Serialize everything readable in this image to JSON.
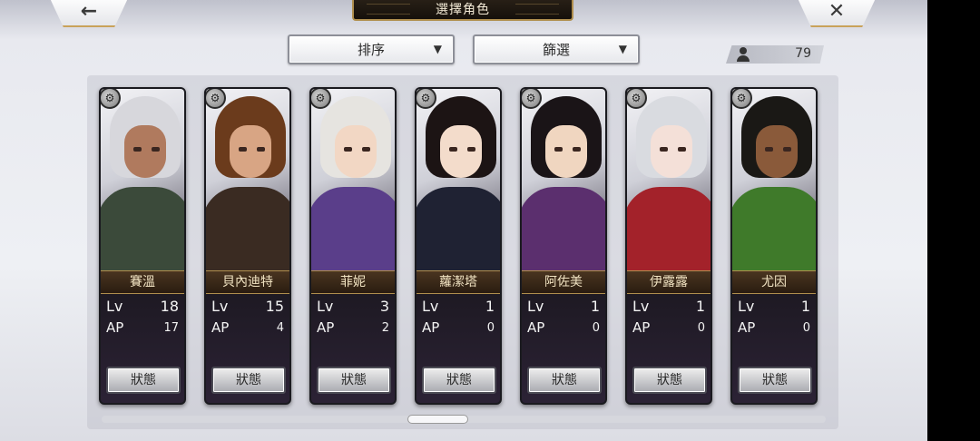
{
  "header": {
    "title": "選擇角色"
  },
  "nav": {
    "back_icon": "←",
    "close_icon": "✕"
  },
  "toolbar": {
    "sort_label": "排序",
    "filter_label": "篩選",
    "dropdown_arrow": "▼",
    "member_count": "79"
  },
  "cards": [
    {
      "name": "賽溫",
      "lv_label": "Lv",
      "lv": "18",
      "ap_label": "AP",
      "ap": "17",
      "status_label": "狀態",
      "hair": "#d7d7dc",
      "skin": "#b07a5e",
      "cloth": "#3b4a3a"
    },
    {
      "name": "貝內迪特",
      "lv_label": "Lv",
      "lv": "15",
      "ap_label": "AP",
      "ap": "4",
      "status_label": "狀態",
      "hair": "#6b3b1c",
      "skin": "#d8a584",
      "cloth": "#3a2b22"
    },
    {
      "name": "菲妮",
      "lv_label": "Lv",
      "lv": "3",
      "ap_label": "AP",
      "ap": "2",
      "status_label": "狀態",
      "hair": "#e6e4e0",
      "skin": "#f2d7c4",
      "cloth": "#5a3e8a"
    },
    {
      "name": "蘿潔塔",
      "lv_label": "Lv",
      "lv": "1",
      "ap_label": "AP",
      "ap": "0",
      "status_label": "狀態",
      "hair": "#1c1414",
      "skin": "#f3dccb",
      "cloth": "#1f2233"
    },
    {
      "name": "阿佐美",
      "lv_label": "Lv",
      "lv": "1",
      "ap_label": "AP",
      "ap": "0",
      "status_label": "狀態",
      "hair": "#1a1417",
      "skin": "#f0d6c0",
      "cloth": "#5b2f6e"
    },
    {
      "name": "伊露露",
      "lv_label": "Lv",
      "lv": "1",
      "ap_label": "AP",
      "ap": "0",
      "status_label": "狀態",
      "hair": "#d9dbe0",
      "skin": "#f4e0d8",
      "cloth": "#a3222a"
    },
    {
      "name": "尤因",
      "lv_label": "Lv",
      "lv": "1",
      "ap_label": "AP",
      "ap": "0",
      "status_label": "狀態",
      "hair": "#1a1815",
      "skin": "#8a5a3a",
      "cloth": "#3f7a2a"
    }
  ]
}
